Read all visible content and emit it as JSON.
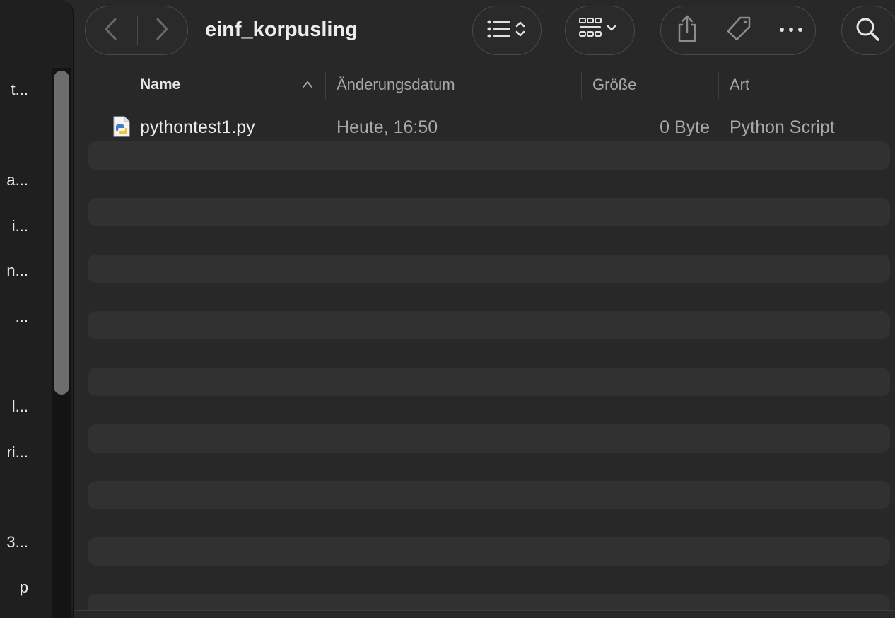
{
  "window": {
    "title": "einf_korpusling"
  },
  "sidebar": {
    "items": [
      {
        "label": "t..."
      },
      {
        "label": "a..."
      },
      {
        "label": "i..."
      },
      {
        "label": "n..."
      },
      {
        "label": "..."
      },
      {
        "label": "l..."
      },
      {
        "label": "ri..."
      },
      {
        "label": "3..."
      },
      {
        "label": "p"
      }
    ]
  },
  "toolbar": {
    "back_icon": "chevron-left-icon",
    "forward_icon": "chevron-right-icon",
    "view_icon": "list-view-icon",
    "group_icon": "grid-group-icon",
    "share_icon": "share-icon",
    "tag_icon": "tag-icon",
    "more_icon": "ellipsis-icon",
    "search_icon": "search-icon"
  },
  "columns": {
    "name": "Name",
    "modified": "Änderungsdatum",
    "size": "Größe",
    "kind": "Art"
  },
  "files": [
    {
      "name": "pythontest1.py",
      "modified": "Heute, 16:50",
      "size": "0 Byte",
      "kind": "Python Script"
    }
  ],
  "colors": {
    "background": "#282828",
    "sidebar": "#1f1f1f",
    "stripe": "#313131",
    "text_primary": "#ececec",
    "text_secondary": "#a8a8a8"
  }
}
